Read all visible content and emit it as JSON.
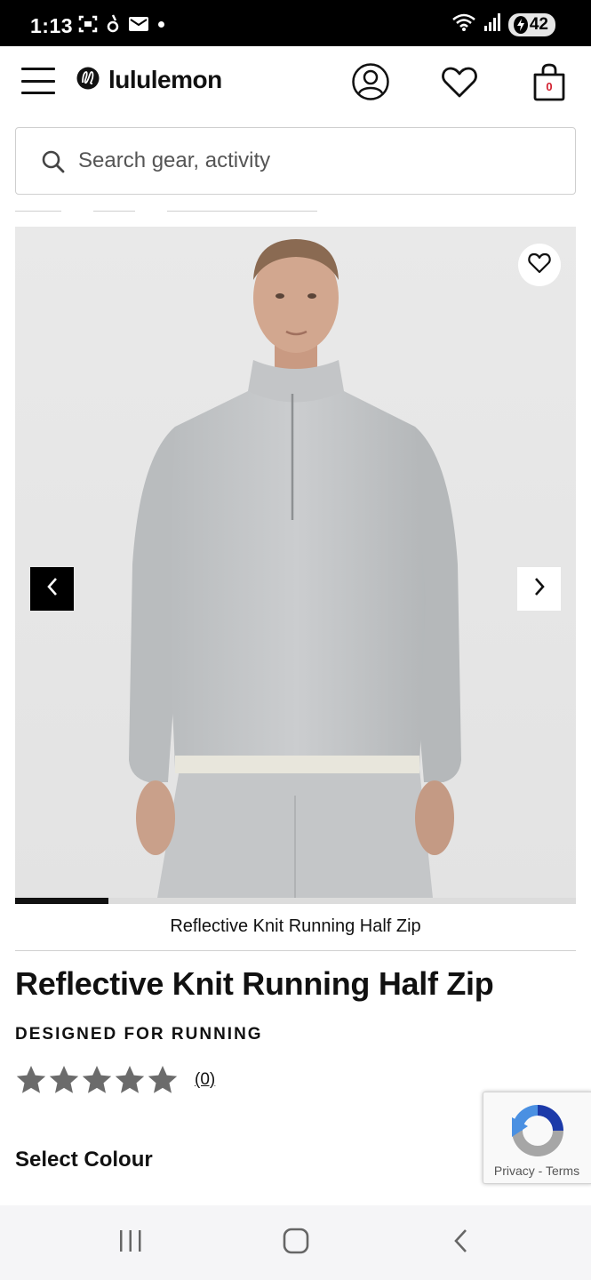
{
  "status_bar": {
    "time": "1:13",
    "battery": "42",
    "icons": [
      "screenshot-icon",
      "activity-icon",
      "mail-icon",
      "dot-icon",
      "wifi-icon",
      "signal-icon",
      "battery-icon"
    ]
  },
  "header": {
    "logo_text": "lululemon",
    "bag_count": "0",
    "icons": [
      "menu-icon",
      "account-icon",
      "wishlist-heart-icon",
      "shopping-bag-icon"
    ]
  },
  "search": {
    "placeholder": "Search gear, activity",
    "value": ""
  },
  "gallery": {
    "caption": "Reflective Knit Running Half Zip",
    "progress_fraction": 0.167,
    "icons": [
      "heart-icon",
      "chevron-left-icon",
      "chevron-right-icon"
    ]
  },
  "product": {
    "title": "Reflective Knit Running Half Zip",
    "activity": "DESIGNED FOR RUNNING",
    "rating_stars": 5,
    "review_count": "(0)",
    "select_colour_label": "Select Colour"
  },
  "recaptcha": {
    "privacy": "Privacy",
    "separator": " - ",
    "terms": "Terms"
  },
  "colors": {
    "brand_red": "#d22030",
    "star_gray": "#6b6b6b",
    "text": "#111111"
  }
}
